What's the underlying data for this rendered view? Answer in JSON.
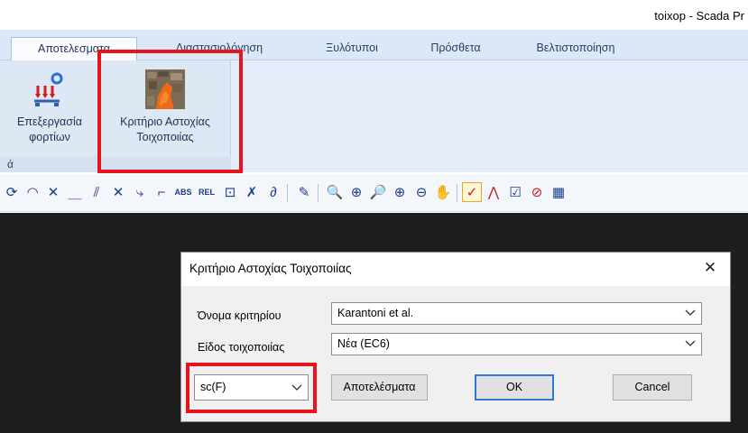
{
  "window": {
    "title": "toixop - Scada Pr"
  },
  "ribbon": {
    "tabs": [
      {
        "label": "Αποτελεσματα",
        "active": true
      },
      {
        "label": "Διαστασιολόγηση",
        "active": false
      },
      {
        "label": "Ξυλότυποι",
        "active": false
      },
      {
        "label": "Πρόσθετα",
        "active": false
      },
      {
        "label": "Βελτιστοποίηση",
        "active": false
      }
    ],
    "buttons": {
      "load_processing": {
        "line1": "Επεξεργασία",
        "line2": "φορτίων",
        "icon": "load-arrows-icon"
      },
      "masonry_criterion": {
        "line1": "Κριτήριο Αστοχίας",
        "line2": "Τοιχοποιίας",
        "icon": "masonry-texture-icon"
      }
    },
    "group_label": "ά"
  },
  "toolbar": {
    "icons": [
      "rotate-icon",
      "arc-icon",
      "cross-icon",
      "dim-line-icon",
      "parallel-icon",
      "intersect-icon",
      "snap-icon",
      "corner-icon",
      "abs-icon",
      "rel-icon",
      "select-box-icon",
      "delete-icon",
      "link-icon",
      "pen-icon",
      "zoom-window-icon",
      "zoom-pan-icon",
      "zoom-prev-icon",
      "zoom-in-icon",
      "zoom-out-icon",
      "hand-pan-icon",
      "check-toggle-icon",
      "chart-line-icon",
      "checkbox-icon",
      "target-icon",
      "grid-colors-icon"
    ],
    "abs_label": "ABS",
    "rel_label": "REL"
  },
  "dialog": {
    "title": "Κριτήριο Αστοχίας Τοιχοποιίας",
    "criterion_label": "Όνομα κριτηρίου",
    "criterion_value": "Karantoni et al.",
    "masonry_type_label": "Είδος τοιχοποιίας",
    "masonry_type_value": "Νέα (EC6)",
    "function_value": "sc(F)",
    "results_button": "Αποτελέσματα",
    "ok_button": "OK",
    "cancel_button": "Cancel"
  },
  "colors": {
    "highlight": "#e8141c",
    "canvas": "#1e1e1e",
    "ribbon": "#dde8f5",
    "default_button_border": "#2f7bd3"
  }
}
